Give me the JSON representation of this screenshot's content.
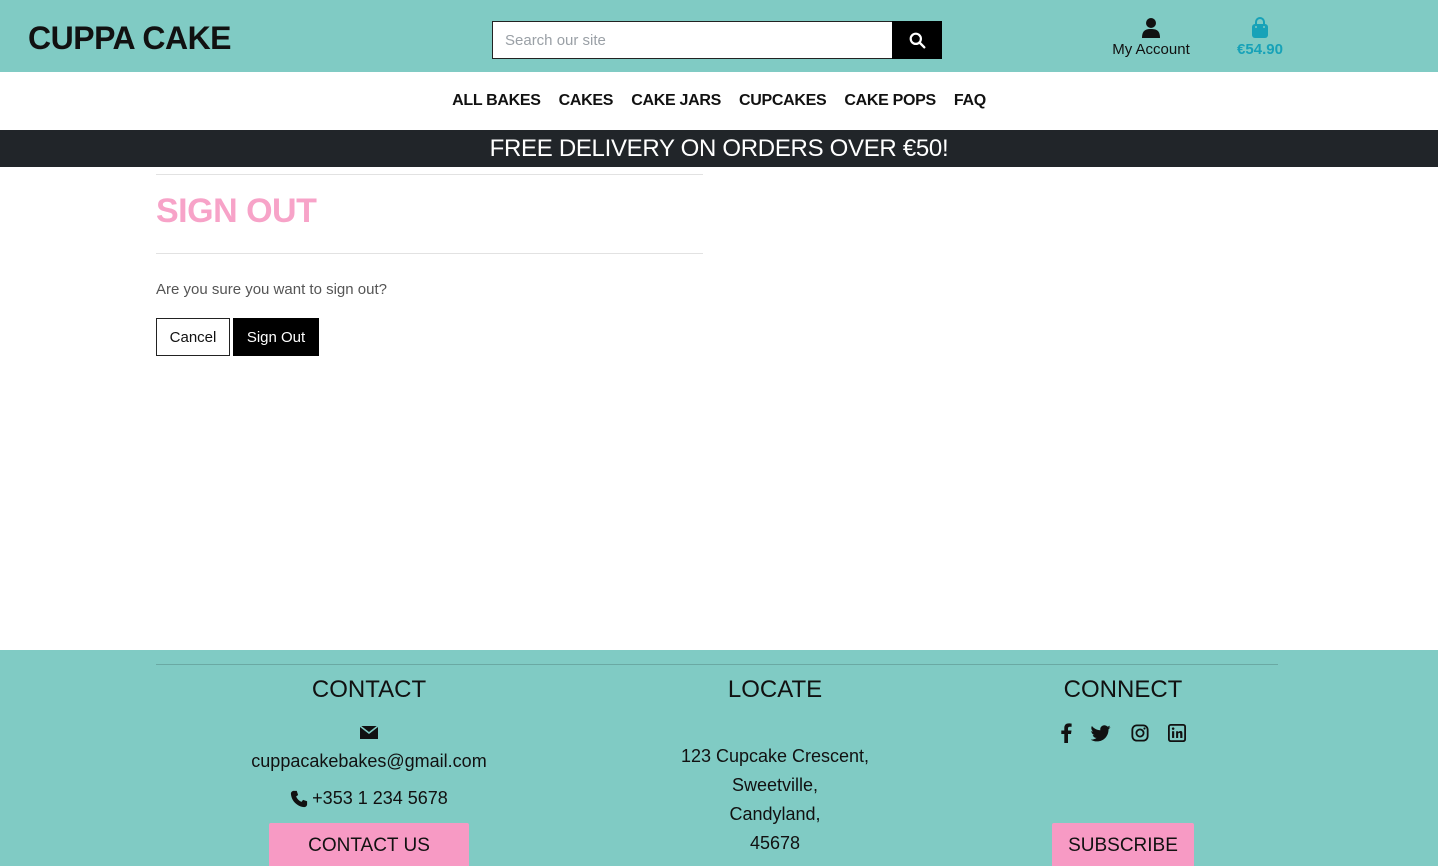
{
  "header": {
    "logo": "CUPPA CAKE",
    "search_placeholder": "Search our site",
    "account_label": "My Account",
    "bag_total": "€54.90"
  },
  "nav": {
    "items": [
      "ALL BAKES",
      "CAKES",
      "CAKE JARS",
      "CUPCAKES",
      "CAKE POPS",
      "FAQ"
    ]
  },
  "banner": "FREE DELIVERY ON ORDERS OVER €50!",
  "main": {
    "title": "SIGN OUT",
    "question": "Are you sure you want to sign out?",
    "cancel_label": "Cancel",
    "signout_label": "Sign Out"
  },
  "footer": {
    "contact": {
      "title": "CONTACT",
      "email": "cuppacakebakes@gmail.com",
      "phone": "+353 1 234 5678",
      "button": "CONTACT US"
    },
    "locate": {
      "title": "LOCATE",
      "address": [
        "123 Cupcake Crescent,",
        "Sweetville,",
        "Candyland,",
        "45678"
      ]
    },
    "connect": {
      "title": "CONNECT",
      "socials": [
        "facebook-icon",
        "twitter-icon",
        "instagram-icon",
        "linkedin-icon"
      ],
      "button": "SUBSCRIBE"
    }
  },
  "colors": {
    "teal": "#80cbc4",
    "pink": "#f7a3c8",
    "dark": "#212529",
    "bag": "#17a2b8"
  }
}
